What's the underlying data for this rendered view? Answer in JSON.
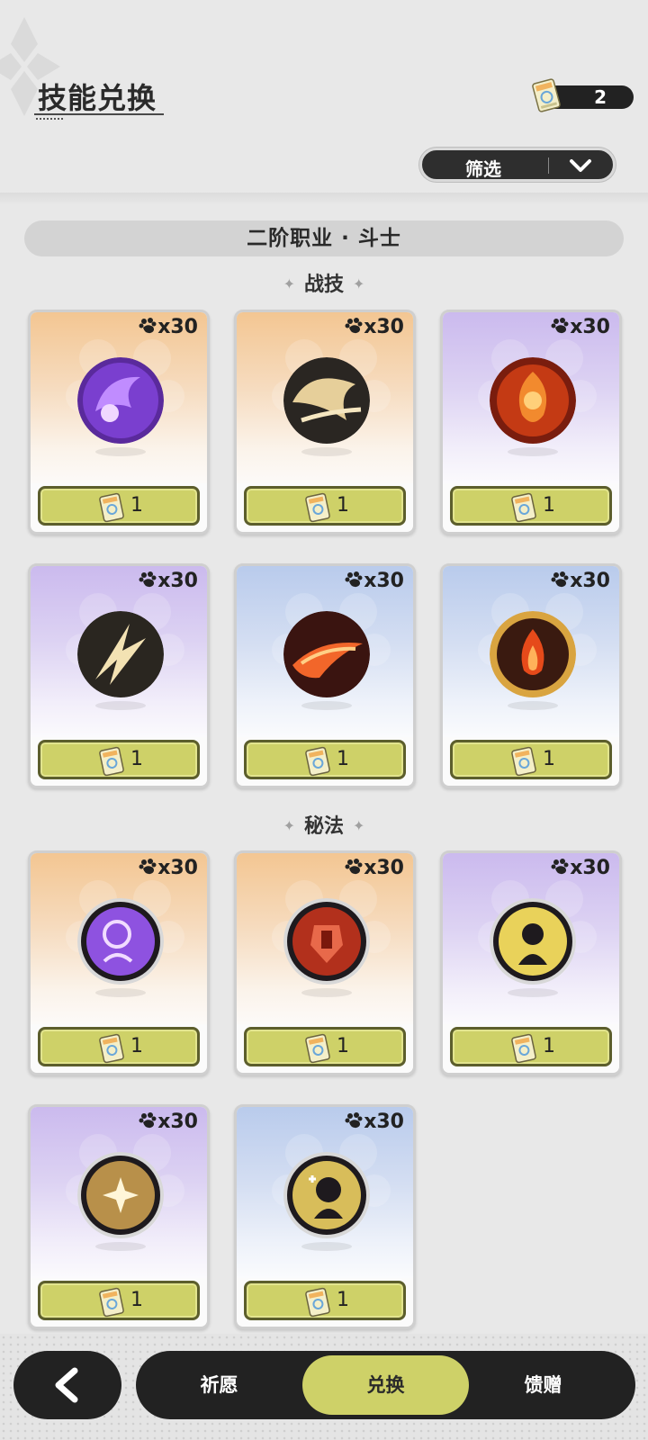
{
  "header": {
    "title": "技能兑换",
    "currency_value": "2",
    "filter_label": "筛选"
  },
  "category": "二阶职业 · 斗士",
  "sections": {
    "combat": "战技",
    "arcane": "秘法"
  },
  "cards": [
    {
      "cost": "x30",
      "price": "1",
      "theme": "orange",
      "icon": "purple-swirl-orb-icon"
    },
    {
      "cost": "x30",
      "price": "1",
      "theme": "orange",
      "icon": "golden-whirl-orb-icon"
    },
    {
      "cost": "x30",
      "price": "1",
      "theme": "purple",
      "icon": "flame-sigil-orb-icon"
    },
    {
      "cost": "x30",
      "price": "1",
      "theme": "purple",
      "icon": "lightning-slash-orb-icon"
    },
    {
      "cost": "x30",
      "price": "1",
      "theme": "blue",
      "icon": "fire-arc-orb-icon"
    },
    {
      "cost": "x30",
      "price": "1",
      "theme": "blue",
      "icon": "flame-ring-orb-icon"
    },
    {
      "cost": "x30",
      "price": "1",
      "theme": "orange",
      "icon": "purple-spirit-emblem-icon"
    },
    {
      "cost": "x30",
      "price": "1",
      "theme": "orange",
      "icon": "red-armor-emblem-icon"
    },
    {
      "cost": "x30",
      "price": "1",
      "theme": "purple",
      "icon": "golden-aura-emblem-icon"
    },
    {
      "cost": "x30",
      "price": "1",
      "theme": "purple",
      "icon": "golden-star-emblem-icon"
    },
    {
      "cost": "x30",
      "price": "1",
      "theme": "blue",
      "icon": "golden-shield-emblem-icon"
    }
  ],
  "nav": {
    "tab_pray": "祈愿",
    "tab_exchange": "兑换",
    "tab_gift": "馈赠"
  },
  "colors": {
    "accent": "#ced168",
    "dark": "#222222",
    "background": "#e8e8e8"
  }
}
